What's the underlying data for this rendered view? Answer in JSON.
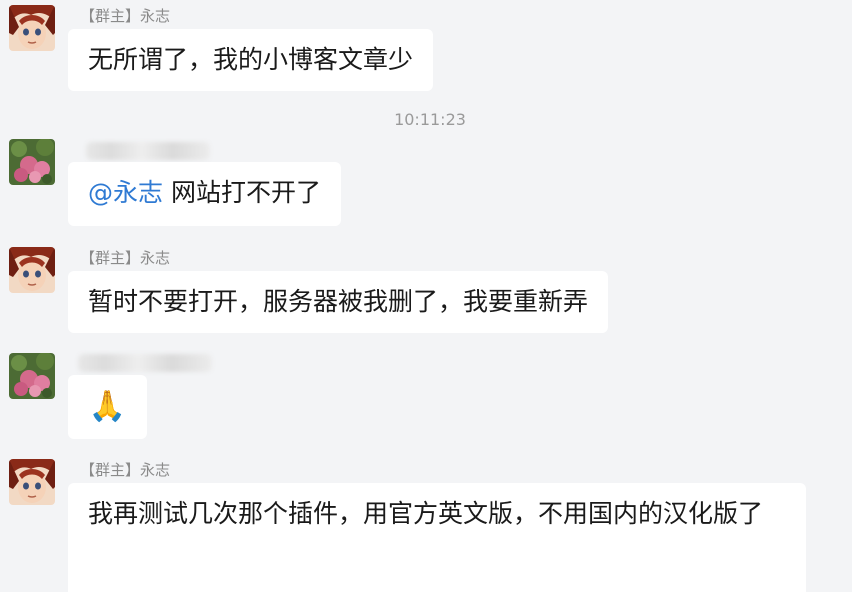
{
  "timestamp": "10:11:23",
  "messages": [
    {
      "role": "【群主】",
      "nick": "永志",
      "text": "无所谓了，我的小博客文章少"
    },
    {
      "mention": "@永志",
      "text": " 网站打不开了"
    },
    {
      "role": "【群主】",
      "nick": "永志",
      "text": "暂时不要打开，服务器被我删了，我要重新弄"
    },
    {
      "emoji": "🙏"
    },
    {
      "role": "【群主】",
      "nick": "永志",
      "text": "我再测试几次那个插件，用官方英文版，不用国内的汉化版了"
    }
  ]
}
